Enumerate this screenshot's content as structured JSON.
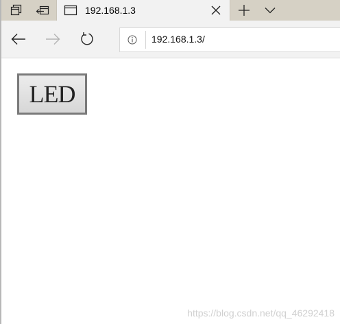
{
  "tabstrip": {
    "tab": {
      "title": "192.168.1.3"
    }
  },
  "toolbar": {
    "back_icon": "back-arrow-icon",
    "forward_icon": "forward-arrow-icon",
    "refresh_icon": "refresh-icon"
  },
  "address_bar": {
    "url": "192.168.1.3/",
    "info_icon": "info-icon"
  },
  "page": {
    "led_button_label": "LED"
  },
  "watermark": "https://blog.csdn.net/qq_46292418",
  "colors": {
    "tab_strip_bg": "#d6d1c5",
    "active_tab_bg": "#f2f2f2",
    "forward_disabled": "#b3b3b3",
    "watermark": "#d0d0d0"
  }
}
